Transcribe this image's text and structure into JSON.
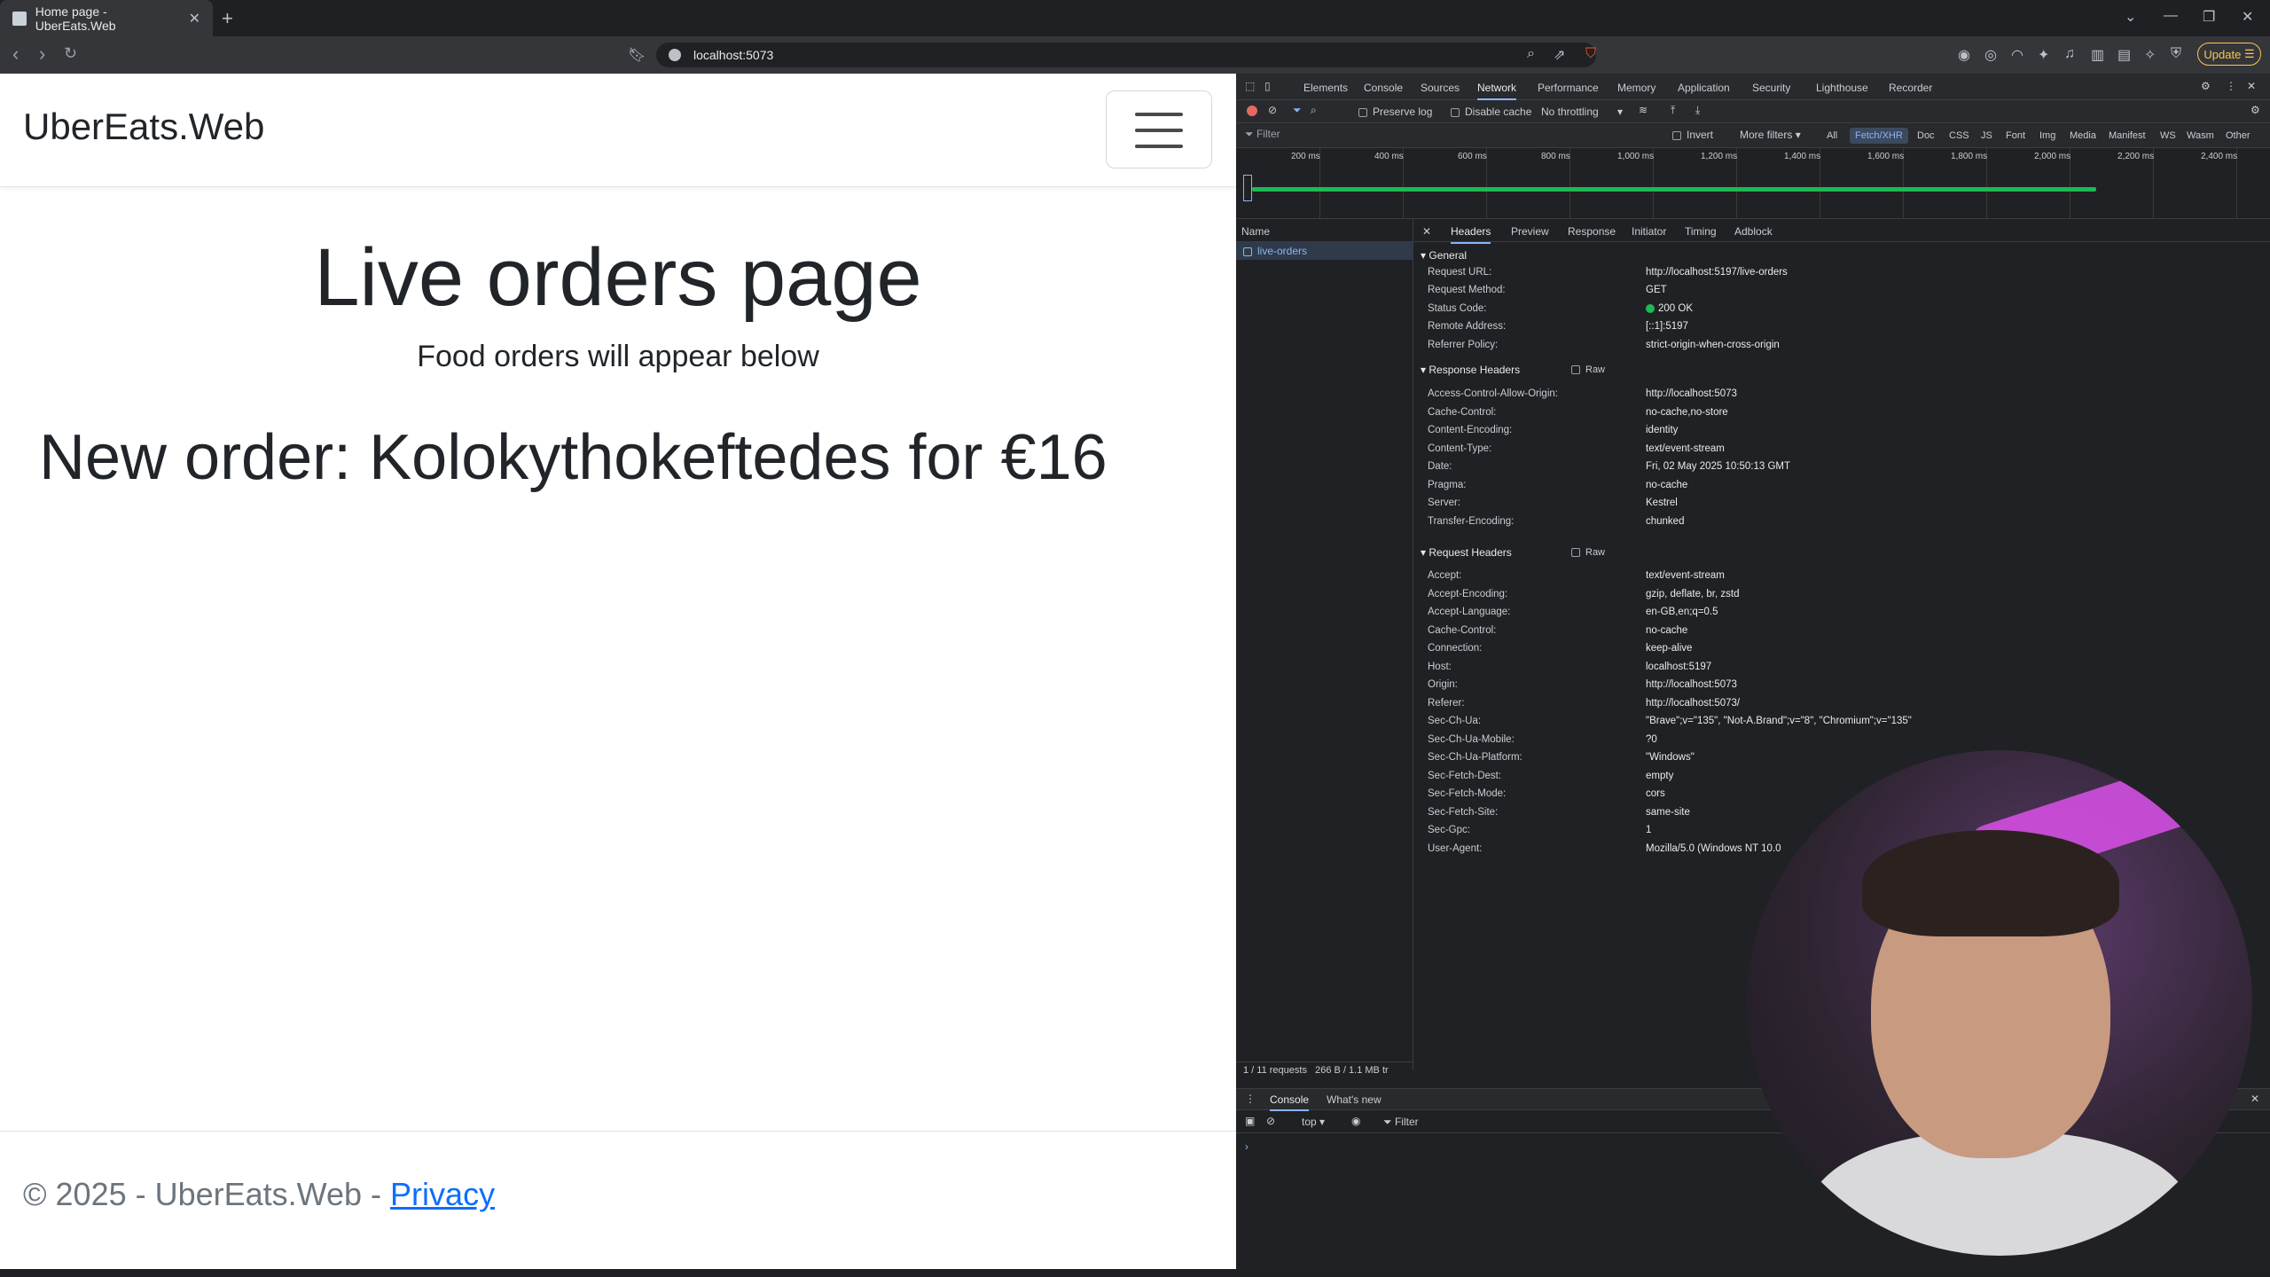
{
  "browser": {
    "tab_title": "Home page - UberEats.Web",
    "url": "localhost:5073",
    "update_label": "Update"
  },
  "page": {
    "brand": "UberEats.Web",
    "heading": "Live orders page",
    "subheading": "Food orders will appear below",
    "order_message": "New order: Kolokythokeftedes for €16",
    "footer_text": "© 2025 - UberEats.Web - ",
    "footer_link": "Privacy"
  },
  "devtools": {
    "tabs": [
      "Elements",
      "Console",
      "Sources",
      "Network",
      "Performance",
      "Memory",
      "Application",
      "Security",
      "Lighthouse",
      "Recorder"
    ],
    "active_tab": "Network",
    "toolbar": {
      "preserve_log": "Preserve log",
      "disable_cache": "Disable cache",
      "throttling": "No throttling"
    },
    "filter_placeholder": "Filter",
    "invert": "Invert",
    "more_filters": "More filters",
    "type_filters": [
      "All",
      "Fetch/XHR",
      "Doc",
      "CSS",
      "JS",
      "Font",
      "Img",
      "Media",
      "Manifest",
      "WS",
      "Wasm",
      "Other"
    ],
    "active_filter": "Fetch/XHR",
    "timeline_ticks": [
      "200 ms",
      "400 ms",
      "600 ms",
      "800 ms",
      "1,000 ms",
      "1,200 ms",
      "1,400 ms",
      "1,600 ms",
      "1,800 ms",
      "2,000 ms",
      "2,200 ms",
      "2,400 ms"
    ],
    "name_header": "Name",
    "request_name": "live-orders",
    "detail_tabs": [
      "Headers",
      "Preview",
      "Response",
      "Initiator",
      "Timing",
      "Adblock"
    ],
    "active_detail_tab": "Headers",
    "general_title": "General",
    "general": [
      {
        "k": "Request URL:",
        "v": "http://localhost:5197/live-orders"
      },
      {
        "k": "Request Method:",
        "v": "GET"
      },
      {
        "k": "Status Code:",
        "v": "200 OK"
      },
      {
        "k": "Remote Address:",
        "v": "[::1]:5197"
      },
      {
        "k": "Referrer Policy:",
        "v": "strict-origin-when-cross-origin"
      }
    ],
    "response_title": "Response Headers",
    "raw_label": "Raw",
    "response_headers": [
      {
        "k": "Access-Control-Allow-Origin:",
        "v": "http://localhost:5073"
      },
      {
        "k": "Cache-Control:",
        "v": "no-cache,no-store"
      },
      {
        "k": "Content-Encoding:",
        "v": "identity"
      },
      {
        "k": "Content-Type:",
        "v": "text/event-stream"
      },
      {
        "k": "Date:",
        "v": "Fri, 02 May 2025 10:50:13 GMT"
      },
      {
        "k": "Pragma:",
        "v": "no-cache"
      },
      {
        "k": "Server:",
        "v": "Kestrel"
      },
      {
        "k": "Transfer-Encoding:",
        "v": "chunked"
      }
    ],
    "request_title": "Request Headers",
    "request_headers": [
      {
        "k": "Accept:",
        "v": "text/event-stream"
      },
      {
        "k": "Accept-Encoding:",
        "v": "gzip, deflate, br, zstd"
      },
      {
        "k": "Accept-Language:",
        "v": "en-GB,en;q=0.5"
      },
      {
        "k": "Cache-Control:",
        "v": "no-cache"
      },
      {
        "k": "Connection:",
        "v": "keep-alive"
      },
      {
        "k": "Host:",
        "v": "localhost:5197"
      },
      {
        "k": "Origin:",
        "v": "http://localhost:5073"
      },
      {
        "k": "Referer:",
        "v": "http://localhost:5073/"
      },
      {
        "k": "Sec-Ch-Ua:",
        "v": "\"Brave\";v=\"135\", \"Not-A.Brand\";v=\"8\", \"Chromium\";v=\"135\""
      },
      {
        "k": "Sec-Ch-Ua-Mobile:",
        "v": "?0"
      },
      {
        "k": "Sec-Ch-Ua-Platform:",
        "v": "\"Windows\""
      },
      {
        "k": "Sec-Fetch-Dest:",
        "v": "empty"
      },
      {
        "k": "Sec-Fetch-Mode:",
        "v": "cors"
      },
      {
        "k": "Sec-Fetch-Site:",
        "v": "same-site"
      },
      {
        "k": "Sec-Gpc:",
        "v": "1"
      },
      {
        "k": "User-Agent:",
        "v": "Mozilla/5.0 (Windows NT 10.0"
      }
    ],
    "status_requests": "1 / 11 requests",
    "status_size": "266 B / 1.1 MB tr",
    "drawer_tabs": [
      "Console",
      "What's new"
    ],
    "drawer_context": "top",
    "drawer_filter": "Filter",
    "console_prompt": "›"
  }
}
